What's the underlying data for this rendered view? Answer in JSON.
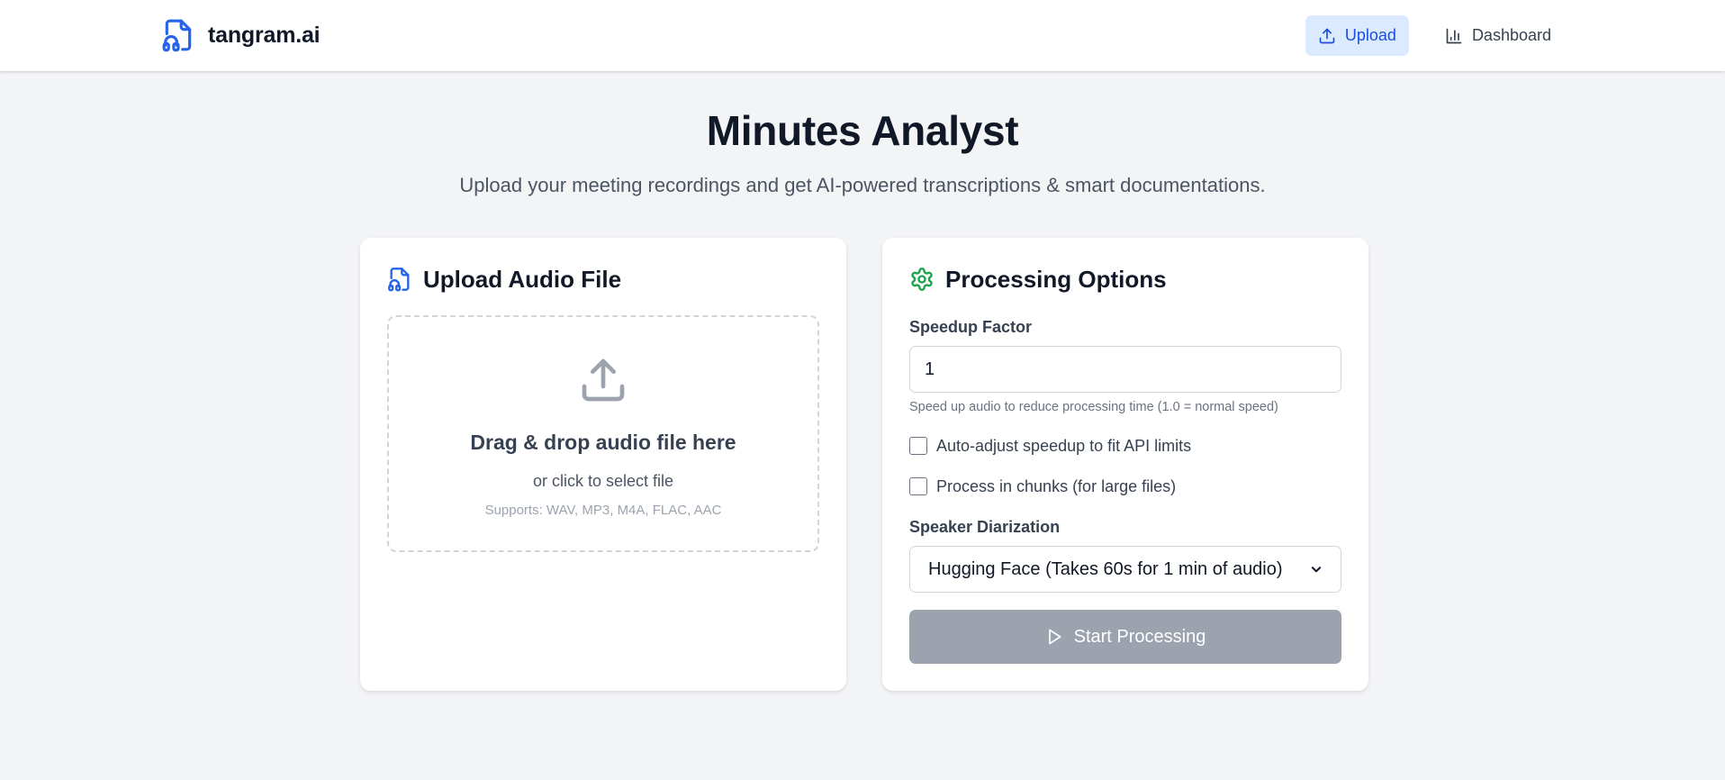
{
  "header": {
    "brand": "tangram.ai",
    "brand_icon": "audio-file-icon",
    "nav": [
      {
        "label": "Upload",
        "icon": "upload-icon",
        "active": true
      },
      {
        "label": "Dashboard",
        "icon": "bar-chart-icon",
        "active": false
      }
    ]
  },
  "hero": {
    "title": "Minutes Analyst",
    "subtitle": "Upload your meeting recordings and get AI-powered transcriptions & smart documentations."
  },
  "upload_card": {
    "title": "Upload Audio File",
    "icon": "audio-file-icon",
    "dropzone": {
      "icon": "upload-icon",
      "title": "Drag & drop audio file here",
      "subtitle": "or click to select file",
      "formats": "Supports: WAV, MP3, M4A, FLAC, AAC"
    }
  },
  "options_card": {
    "title": "Processing Options",
    "icon": "gear-icon",
    "speedup": {
      "label": "Speedup Factor",
      "value": "1",
      "hint": "Speed up audio to reduce processing time (1.0 = normal speed)"
    },
    "auto_adjust": {
      "label": "Auto-adjust speedup to fit API limits",
      "checked": false
    },
    "chunks": {
      "label": "Process in chunks (for large files)",
      "checked": false
    },
    "diarization": {
      "label": "Speaker Diarization",
      "selected": "Hugging Face (Takes 60s for 1 min of audio)"
    },
    "start_button": {
      "label": "Start Processing",
      "icon": "play-icon",
      "disabled": true
    }
  },
  "colors": {
    "accent": "#2563eb",
    "accent_bg": "#dbeafe",
    "gear": "#16a34a",
    "page_bg": "#f3f4f6",
    "disabled_button": "#9ca3af"
  }
}
